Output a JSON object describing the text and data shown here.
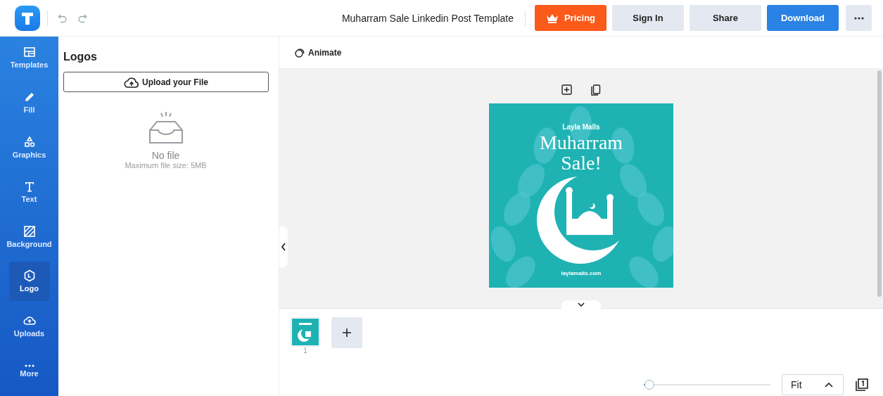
{
  "header": {
    "title": "Muharram Sale Linkedin Post Template",
    "buttons": [
      {
        "label": "Pricing",
        "kind": "pricing"
      },
      {
        "label": "Sign In",
        "kind": "plain"
      },
      {
        "label": "Share",
        "kind": "plain"
      },
      {
        "label": "Download",
        "kind": "primary"
      }
    ]
  },
  "sidebar": {
    "items": [
      {
        "label": "Templates",
        "selected": false
      },
      {
        "label": "Fill",
        "selected": false
      },
      {
        "label": "Graphics",
        "selected": false
      },
      {
        "label": "Text",
        "selected": false
      },
      {
        "label": "Background",
        "selected": false
      },
      {
        "label": "Logo",
        "selected": true
      },
      {
        "label": "Uploads",
        "selected": false
      },
      {
        "label": "More",
        "selected": false
      }
    ]
  },
  "panel": {
    "title": "Logos",
    "upload_button": "Upload your File",
    "empty_title": "No file",
    "empty_hint": "Maximum file size: 5MB"
  },
  "toolbar": {
    "animate": "Animate"
  },
  "design": {
    "brand": "Layla Malls",
    "headline": "Muharram Sale!",
    "website": "laylamalls.com"
  },
  "pages": [
    {
      "number": "1",
      "selected": true
    }
  ],
  "zoom": {
    "level": 0.02,
    "fit": "Fit"
  }
}
